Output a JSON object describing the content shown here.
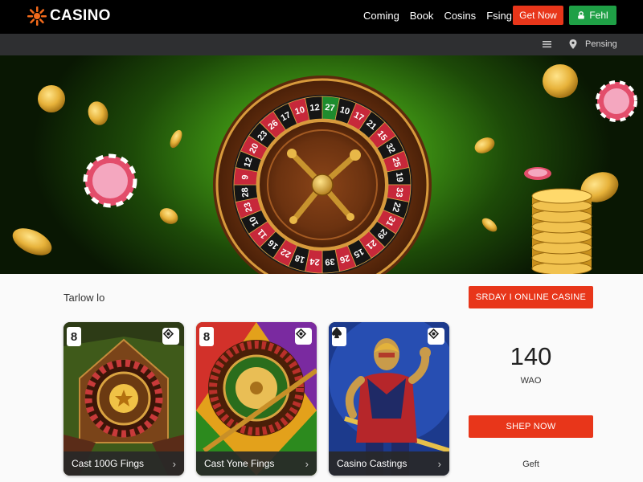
{
  "header": {
    "brand": "CASINO",
    "nav": [
      "Coming",
      "Book",
      "Cosins",
      "Fsing"
    ],
    "get_now_label": "Get Now",
    "fehl_label": "Fehl"
  },
  "subbar": {
    "label": "Pensing"
  },
  "hero": {
    "wheel_numbers": [
      "27",
      "10",
      "17",
      "21",
      "15",
      "32",
      "25",
      "19",
      "33",
      "22",
      "31",
      "29",
      "21",
      "15",
      "26",
      "39",
      "24",
      "18",
      "22",
      "16",
      "11",
      "10",
      "23",
      "28",
      "9",
      "12",
      "20",
      "23",
      "26",
      "17",
      "10",
      "12"
    ]
  },
  "section": {
    "title": "Tarlow lo"
  },
  "cards": [
    {
      "badge": "8",
      "label": "Cast 100G Fings",
      "chevron": "›"
    },
    {
      "badge": "8",
      "label": "Cast Yone Fings",
      "chevron": "›"
    },
    {
      "badge": "A",
      "label": "Casino Castings",
      "chevron": "›"
    }
  ],
  "promo": {
    "top_button": "SRDAY I ONLINE CASINE",
    "stat_value": "140",
    "stat_label": "WAO",
    "shop_button": "SHEP NOW",
    "footer_label": "Geft"
  },
  "colors": {
    "accent_red": "#e8361a",
    "accent_green": "#1fa046",
    "topbar": "#000000",
    "subbar": "#2e2f31"
  }
}
